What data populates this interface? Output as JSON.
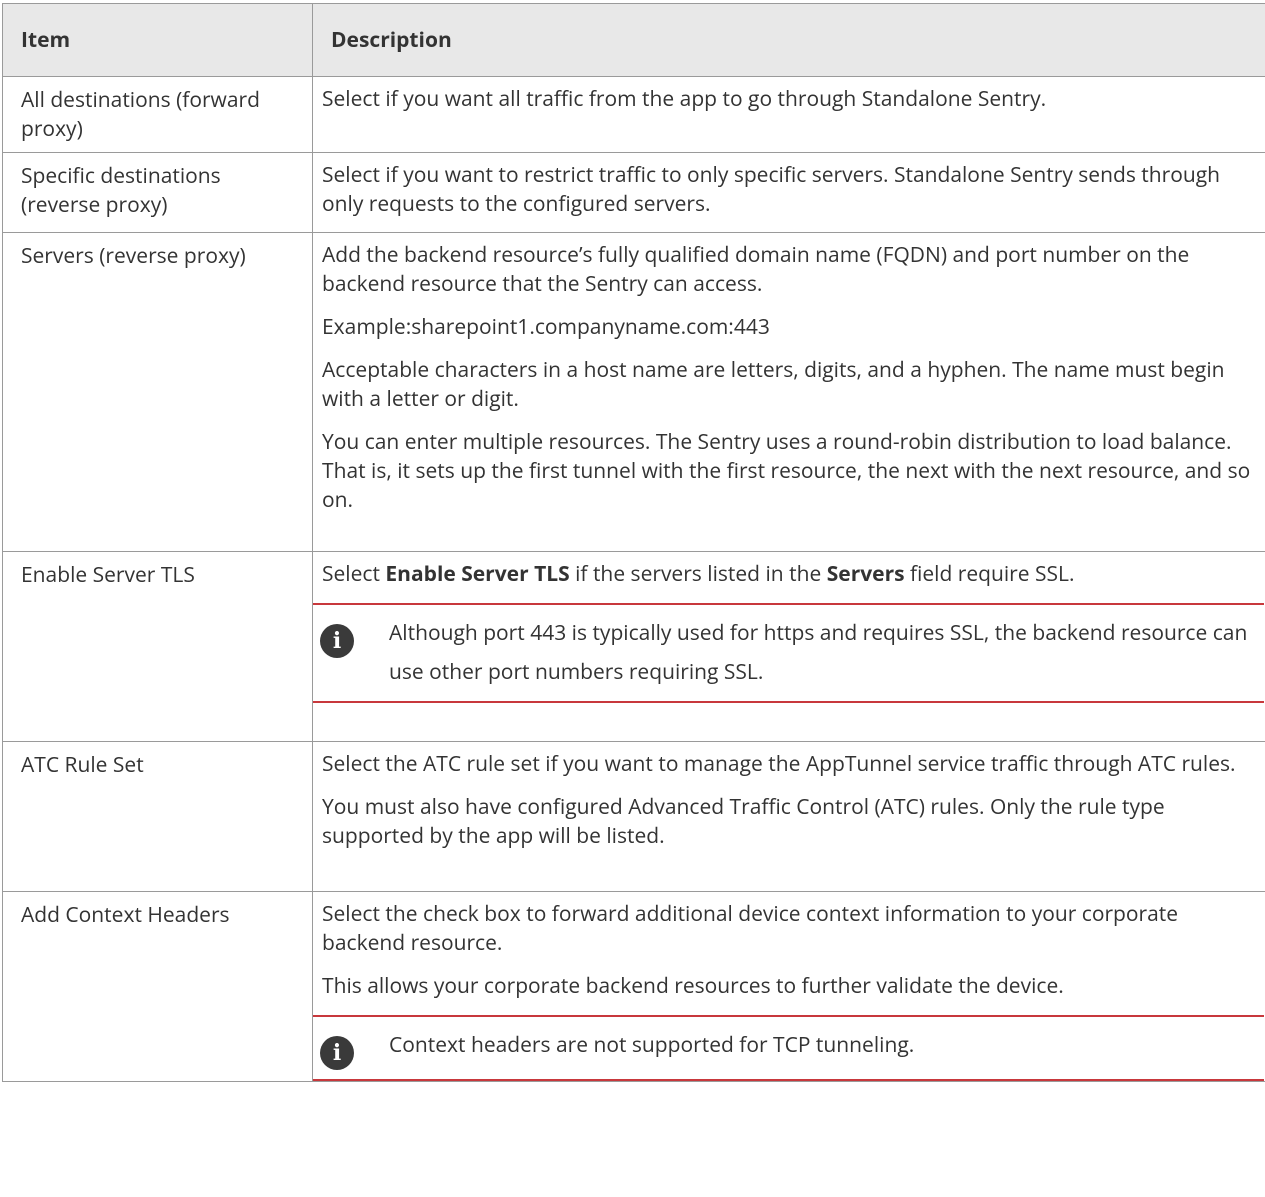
{
  "table": {
    "headers": [
      "Item",
      "Description"
    ],
    "rows": [
      {
        "item": "All destinations (forward proxy)",
        "desc": [
          "Select if you want all traffic from the app to go through Standalone Sentry."
        ]
      },
      {
        "item": "Specific destinations (reverse proxy)",
        "desc": [
          "Select if you want to restrict traffic to only specific servers. Standalone Sentry sends through only requests to the configured servers."
        ]
      },
      {
        "item": "Servers (reverse proxy)",
        "desc": [
          "Add the backend resource’s fully qualified domain name (FQDN) and port number on the backend resource that the Sentry can access.",
          "Example:sharepoint1.companyname.com:443",
          "Acceptable characters in a host name are letters, digits, and a hyphen. The name must begin with a letter or digit.",
          "You can enter multiple resources. The Sentry uses a round-robin distribution to load balance. That is, it sets up the first tunnel with the first resource, the next with the next resource, and so on."
        ]
      },
      {
        "item": "Enable Server TLS",
        "desc_parts": {
          "p1": "Select ",
          "b1": "Enable Server TLS",
          "p2": " if the servers listed in the ",
          "b2": "Servers",
          "p3": " field require SSL."
        },
        "note": "Although port 443 is typically used for https and requires SSL, the backend resource can use other port numbers requiring SSL."
      },
      {
        "item": "ATC Rule Set",
        "desc": [
          "Select the ATC rule set if you want to manage the AppTunnel service traffic through ATC rules.",
          "You must also have configured Advanced Traffic Control (ATC) rules. Only the rule type supported by the app will be listed."
        ]
      },
      {
        "item": "Add Context Headers",
        "desc": [
          "Select the check box to forward additional device context information to your corporate backend resource.",
          "This allows your corporate backend resources to further validate the device."
        ],
        "note": "Context headers are not supported for TCP tunneling."
      }
    ]
  },
  "icons": {
    "note": "info-icon"
  },
  "colors": {
    "header_bg": "#e8e8e8",
    "note_rule": "#c8383c",
    "border": "#9a9a9a"
  }
}
